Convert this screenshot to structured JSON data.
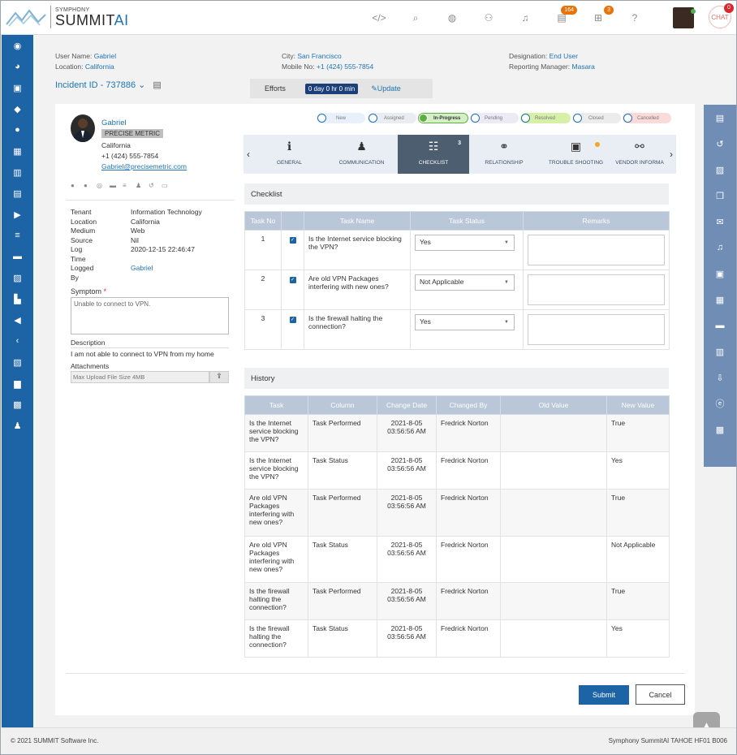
{
  "brand": {
    "small": "SYMPHONY",
    "main": "SUMMIT",
    "ai": "AI"
  },
  "topbar": {
    "badge_tickets": "164",
    "badge_cart": "3",
    "badge_chat": "0",
    "chat_label": "CHAT"
  },
  "user_info": {
    "user_name_label": "User Name:",
    "user_name": "Gabriel",
    "location_label": "Location:",
    "location": "California",
    "city_label": "City:",
    "city": "San Francisco",
    "mobile_label": "Mobile No:",
    "mobile": "+1 (424) 555-7854",
    "designation_label": "Designation:",
    "designation": "End User",
    "manager_label": "Reporting Manager:",
    "manager": "Masara"
  },
  "incident": {
    "id": "Incident ID - 737886",
    "efforts_label": "Efforts",
    "efforts_value": "0 day 0 hr 0 min",
    "update_label": "Update"
  },
  "profile": {
    "name": "Gabriel",
    "org": "PRECISE METRIC",
    "state": "California",
    "phone": "+1 (424) 555-7854",
    "email": "Gabriel@precisemetric.com"
  },
  "details": {
    "tenant_label": "Tenant",
    "tenant": "Information Technology",
    "location_label": "Location",
    "location": "California",
    "medium_label": "Medium",
    "medium": "Web",
    "source_label": "Source",
    "source": "Nil",
    "logtime_label1": "Log",
    "logtime_label2": "Time",
    "logtime": "2020-12-15 22:46:47",
    "loggedby_label1": "Logged",
    "loggedby_label2": "By",
    "loggedby": "Gabriel",
    "symptom_label": "Symptom",
    "symptom": "Unable to connect to VPN.",
    "description_label": "Description",
    "description": "I am not able to connect to VPN from my home",
    "attachments_label": "Attachments",
    "upload_placeholder": "Max Upload File Size 4MB"
  },
  "statuses": [
    "New",
    "Assigned",
    "In-Progress",
    "Pending",
    "Resolved",
    "Closed",
    "Cancelled"
  ],
  "tabs": {
    "general": "GENERAL",
    "communication": "COMMUNICATION",
    "checklist": "CHECKLIST",
    "checklist_count": "3",
    "relationship": "RELATIONSHIP",
    "troubleshooting": "TROUBLE SHOOTING",
    "vendor": "VENDOR INFORMA"
  },
  "checklist": {
    "title": "Checklist",
    "headers": [
      "Task No",
      "Task Name",
      "Task Status",
      "Remarks"
    ],
    "rows": [
      {
        "no": "1",
        "name": "Is the Internet service blocking the VPN?",
        "status": "Yes"
      },
      {
        "no": "2",
        "name": "Are old VPN Packages interfering with new ones?",
        "status": "Not Applicable"
      },
      {
        "no": "3",
        "name": "Is the firewall halting the connection?",
        "status": "Yes"
      }
    ]
  },
  "history": {
    "title": "History",
    "headers": [
      "Task",
      "Column",
      "Change Date",
      "Changed By",
      "Old Value",
      "New Value"
    ],
    "rows": [
      {
        "task": "Is the Internet service blocking the VPN?",
        "column": "Task Performed",
        "date": "2021-8-05 03:56:56 AM",
        "by": "Fredrick Norton",
        "old": "",
        "new": "True"
      },
      {
        "task": "Is the Internet service blocking the VPN?",
        "column": "Task Status",
        "date": "2021-8-05 03:56:56 AM",
        "by": "Fredrick Norton",
        "old": "",
        "new": "Yes"
      },
      {
        "task": "Are old VPN Packages interfering with new ones?",
        "column": "Task Performed",
        "date": "2021-8-05 03:56:56 AM",
        "by": "Fredrick Norton",
        "old": "",
        "new": "True"
      },
      {
        "task": "Are old VPN Packages interfering with new ones?",
        "column": "Task Status",
        "date": "2021-8-05 03:56:56 AM",
        "by": "Fredrick Norton",
        "old": "",
        "new": "Not Applicable"
      },
      {
        "task": "Is the firewall halting the connection?",
        "column": "Task Performed",
        "date": "2021-8-05 03:56:56 AM",
        "by": "Fredrick Norton",
        "old": "",
        "new": "True"
      },
      {
        "task": "Is the firewall halting the connection?",
        "column": "Task Status",
        "date": "2021-8-05 03:56:56 AM",
        "by": "Fredrick Norton",
        "old": "",
        "new": "Yes"
      }
    ]
  },
  "actions": {
    "submit": "Submit",
    "cancel": "Cancel"
  },
  "footer": {
    "copyright": "© 2021 SUMMIT Software Inc.",
    "version": "Symphony SummitAI TAHOE HF01 B006"
  }
}
